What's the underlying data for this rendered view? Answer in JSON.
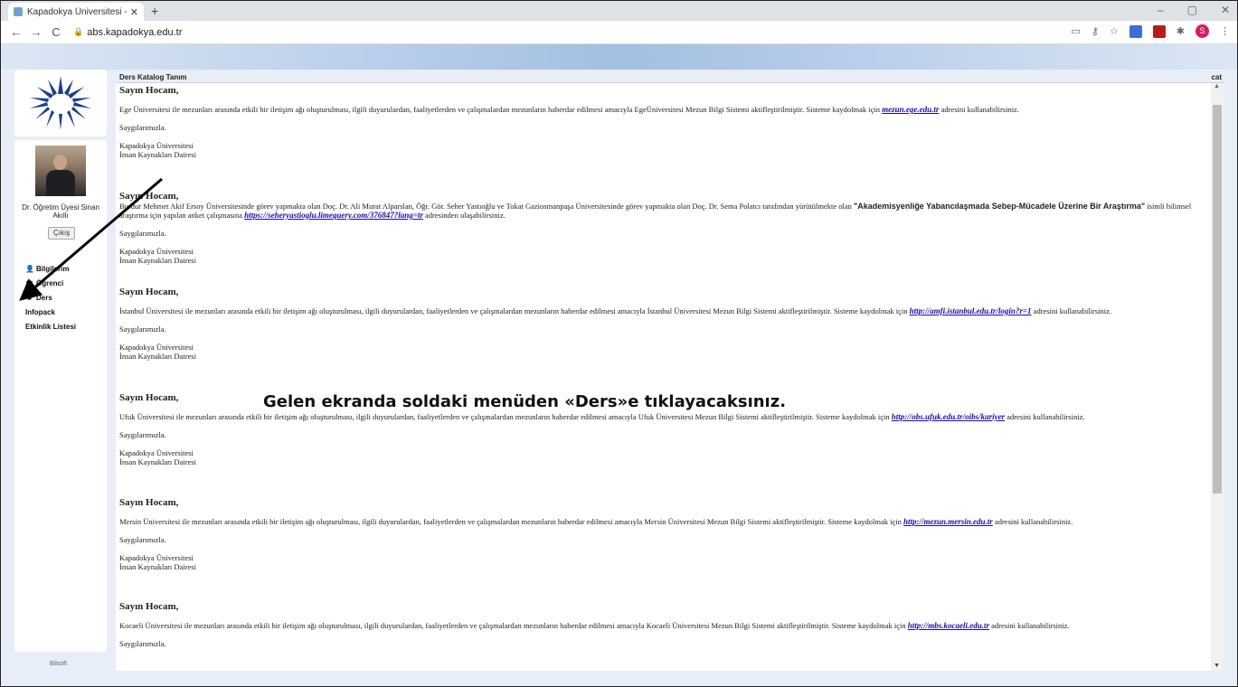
{
  "browser": {
    "tab_title": "Kapadokya Üniversitesi - Akadem",
    "tab_close": "✕",
    "new_tab": "+",
    "url": "abs.kapadokya.edu.tr",
    "win_minimize": "–",
    "win_restore": "▢",
    "win_close": "✕",
    "profile_initial": "S"
  },
  "sidebar": {
    "user_name": "Dr. Öğretim Üyesi Sinan Akıllı",
    "logout_label": "Çıkış",
    "menu": [
      {
        "label": "Bilgilerim",
        "icon": "user-icon"
      },
      {
        "label": "Öğrenci",
        "icon": "grid-icon"
      },
      {
        "label": "Ders",
        "icon": "book-icon"
      },
      {
        "label": "Infopack",
        "icon": ""
      },
      {
        "label": "Etkinlik Listesi",
        "icon": ""
      }
    ],
    "footer": "Bilsoft"
  },
  "main": {
    "header_title": "Ders Katalog Tanım",
    "header_right": "cat",
    "messages": [
      {
        "greeting": "Sayın Hocam,",
        "text_before": "Ege Üniversitesi ile mezunları arasında etkili bir iletişim ağı oluşturulması, ilgili duyurulardan, faaliyetlerden ve çalışmalardan mezunların haberdar edilmesi amacıyla EgeÜniversitesi Mezun Bilgi Sistemi aktifleştirilmiştir. Sisteme kaydolmak için",
        "link": "mezun.ege.edu.tr",
        "text_after": "adresini kullanabilirsiniz.",
        "closing": "Saygılarımızla.",
        "sign1": "Kapadokya Üniversitesi",
        "sign2": "İnsan Kaynakları Dairesi"
      },
      {
        "greeting": "Sayın Hocam,",
        "text_before": "Burdur Mehmet Akif Ersoy Üniversitesinde görev yapmakta olan Doç. Dr. Ali Murat Alparslan, Öğr. Gör. Seher Yastıoğlu ve Tokat Gaziosmanpaşa Üniversitesinde görev yapmakta olan Doç. Dr. Sema Polatcı tarafından yürütülmekte olan",
        "bold_title": "\"Akademisyenliğe Yabancılaşmada Sebep-Mücadele Üzerine Bir Araştırma\"",
        "text_mid": "isimli bilimsel araştırma için yapılan anket çalışmasına",
        "link": "https://seheryastioglu.limequery.com/376847?lang=tr",
        "text_after": "adresinden ulaşabilirsiniz.",
        "closing": "Saygılarımızla.",
        "sign1": "Kapadokya Üniversitesi",
        "sign2": "İnsan Kaynakları Dairesi"
      },
      {
        "greeting": "Sayın Hocam,",
        "text_before": "İstanbul Üniversitesi ile mezunları arasında etkili bir iletişim ağı oluşturulması, ilgili duyurulardan, faaliyetlerden ve çalışmalardan mezunların haberdar edilmesi amacıyla İstanbul Üniversitesi Mezun Bilgi Sistemi aktifleştirilmiştir. Sisteme kaydolmak için",
        "link": "http://amfi.istanbul.edu.tr/login?r=1",
        "text_after": "adresini kullanabilirsiniz.",
        "closing": "Saygılarımızla.",
        "sign1": "Kapadokya Üniversitesi",
        "sign2": "İnsan Kaynakları Dairesi"
      },
      {
        "greeting": "Sayın Hocam,",
        "text_before": "Ufuk Üniversitesi ile mezunları arasında etkili bir iletişim ağı oluşturulması, ilgili duyurulardan, faaliyetlerden ve çalışmalardan mezunların haberdar edilmesi amacıyla Ufuk Üniversitesi Mezun Bilgi Sistemi aktifleştirilmiştir. Sisteme kaydolmak için",
        "link": "http://obs.ufuk.edu.tr/oibs/kariyer",
        "text_after": "adresini kullanabilirsiniz.",
        "closing": "Saygılarımızla.",
        "sign1": "Kapadokya Üniversitesi",
        "sign2": "İnsan Kaynakları Dairesi"
      },
      {
        "greeting": "Sayın Hocam,",
        "text_before": "Mersin Üniversitesi ile mezunları arasında etkili bir iletişim ağı oluşturulması, ilgili duyurulardan, faaliyetlerden ve çalışmalardan mezunların haberdar edilmesi amacıyla Mersin Üniversitesi Mezun Bilgi Sistemi aktifleştirilmiştir. Sisteme kaydolmak için",
        "link": "http://mezun.mersin.edu.tr",
        "text_after": "adresini kullanabilirsiniz.",
        "closing": "Saygılarımızla.",
        "sign1": "Kapadokya Üniversitesi",
        "sign2": "İnsan Kaynakları Dairesi"
      },
      {
        "greeting": "Sayın Hocam,",
        "text_before": "Kocaeli Üniversitesi ile mezunları arasında etkili bir iletişim ağı oluşturulması, ilgili duyurulardan, faaliyetlerden ve çalışmalardan mezunların haberdar edilmesi amacıyla Kocaeli Üniversitesi Mezun Bilgi Sistemi aktifleştirilmiştir. Sisteme kaydolmak için",
        "link": "http://mbs.kocaeli.edu.tr",
        "text_after": "adresini kullanabilirsiniz.",
        "closing": "Saygılarımızla."
      }
    ]
  },
  "overlay": {
    "instruction": "Gelen ekranda soldaki menüden «Ders»e tıklayacaksınız."
  },
  "colors": {
    "link": "#1a0dab",
    "page_bg": "#e8eef7",
    "logo_blue": "#1d3f8a"
  }
}
